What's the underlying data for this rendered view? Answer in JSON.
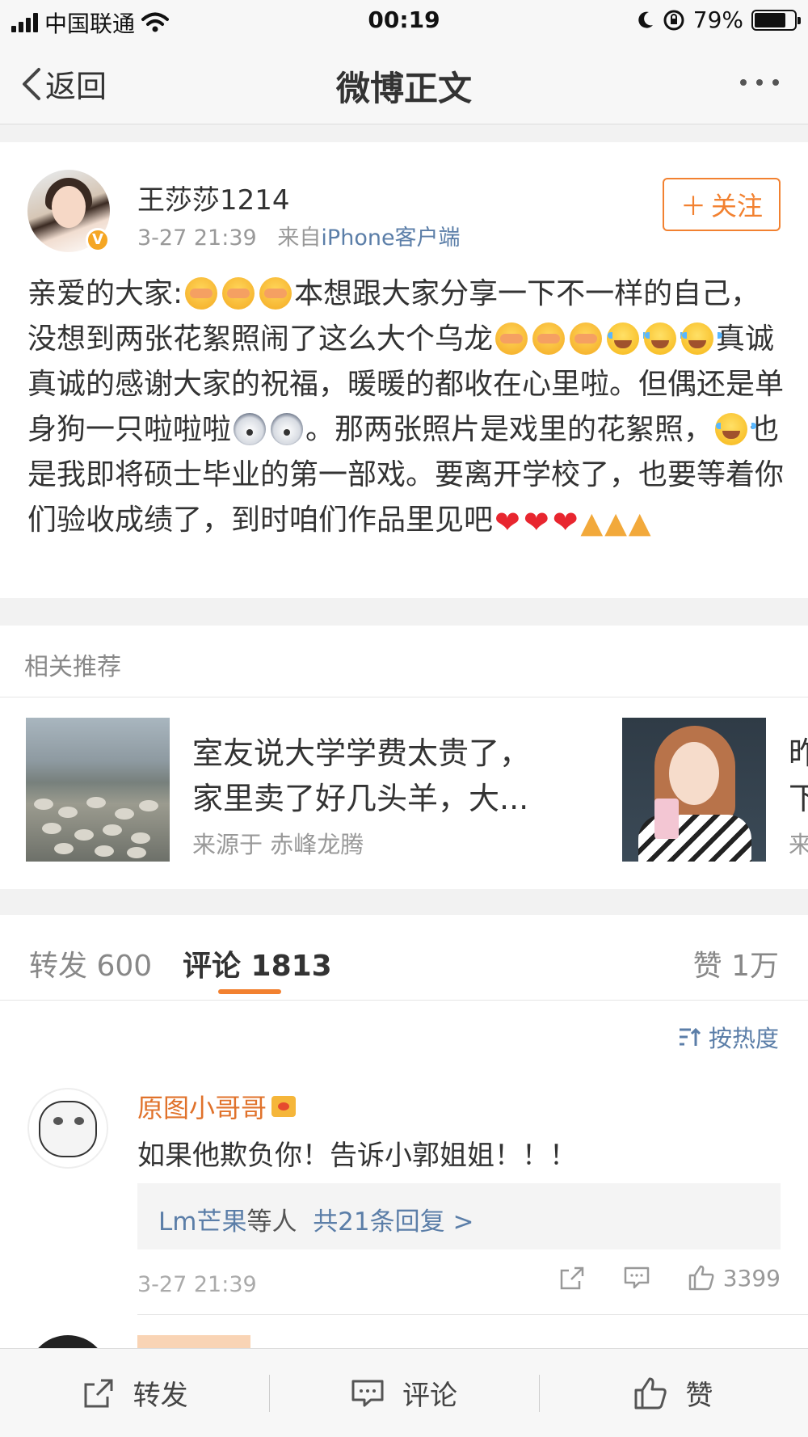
{
  "status_bar": {
    "carrier": "中国联通",
    "time": "00:19",
    "battery_percent": "79%",
    "battery_level": 0.79
  },
  "nav": {
    "back_label": "返回",
    "title": "微博正文"
  },
  "post": {
    "username": "王莎莎1214",
    "timestamp": "3-27 21:39",
    "source_prefix": "来自",
    "source": "iPhone客户端",
    "follow_label": "关注",
    "text_segments": [
      "亲爱的大家:",
      "本想跟大家分享一下不一样的自己，没想到两张花絮照闹了这么大个乌龙",
      "真诚真诚的感谢大家的祝福，暖暖的都收在心里啦。但偶还是单身狗一只啦啦啦",
      "。那两张照片是戏里的花絮照，",
      "也是我即将硕士毕业的第一部戏。要离开学校了，也要等着你们验收成绩了，到时咱们作品里见吧"
    ]
  },
  "related": {
    "title": "相关推荐",
    "items": [
      {
        "line1": "室友说大学学费太贵了，",
        "line2": "家里卖了好几头羊，大...",
        "source": "来源于 赤峰龙腾"
      },
      {
        "line1": "昨",
        "line2": "下",
        "source": "来"
      }
    ]
  },
  "tabs": {
    "repost": "转发 600",
    "comments": "评论 1813",
    "likes": "赞 1万"
  },
  "comments": {
    "sort_label": "按热度",
    "items": [
      {
        "username": "原图小哥哥",
        "text": "如果他欺负你！告诉小郭姐姐！！！",
        "reply_user": "Lm芒果",
        "reply_mid": "等人",
        "reply_link": "共21条回复 >",
        "time": "3-27 21:39",
        "like_count": "3399"
      }
    ]
  },
  "bottom_bar": {
    "repost": "转发",
    "comment": "评论",
    "like": "赞"
  },
  "colors": {
    "accent_orange": "#f28130",
    "link_blue": "#5b7ea8"
  }
}
